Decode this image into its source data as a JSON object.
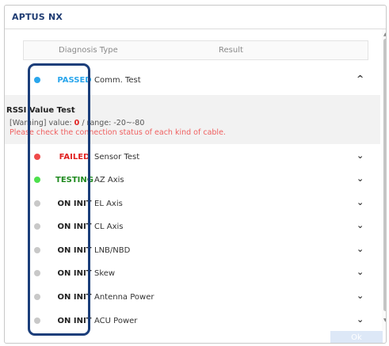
{
  "window": {
    "title": "APTUS NX"
  },
  "table_header": {
    "type_label": "Diagnosis Type",
    "result_label": "Result"
  },
  "rows": [
    {
      "status": "PASSED",
      "type": "Comm. Test",
      "dot_color": "#2aa6ec",
      "status_color": "#2aa6ec",
      "chevron": "^"
    },
    {
      "status": "FAILED",
      "type": "Sensor Test",
      "dot_color": "#ef4a4a",
      "status_color": "#e02020",
      "chevron": "⌄"
    },
    {
      "status": "TESTING",
      "type": "AZ Axis",
      "dot_color": "#4de04d",
      "status_color": "#1f8a1f",
      "chevron": "⌄"
    },
    {
      "status": "ON INIT",
      "type": "EL Axis",
      "dot_color": "#c8c8c8",
      "status_color": "#222222",
      "chevron": "⌄"
    },
    {
      "status": "ON INIT",
      "type": "CL Axis",
      "dot_color": "#c8c8c8",
      "status_color": "#222222",
      "chevron": "⌄"
    },
    {
      "status": "ON INIT",
      "type": "LNB/NBD",
      "dot_color": "#c8c8c8",
      "status_color": "#222222",
      "chevron": "⌄"
    },
    {
      "status": "ON INIT",
      "type": "Skew",
      "dot_color": "#c8c8c8",
      "status_color": "#222222",
      "chevron": "⌄"
    },
    {
      "status": "ON INIT",
      "type": "Antenna Power",
      "dot_color": "#c8c8c8",
      "status_color": "#222222",
      "chevron": "⌄"
    },
    {
      "status": "ON INIT",
      "type": "ACU Power",
      "dot_color": "#c8c8c8",
      "status_color": "#222222",
      "chevron": "⌄"
    }
  ],
  "detail": {
    "title": "RSSI Value Test",
    "warning_prefix": "[Warning] value: ",
    "warning_value": "0",
    "warning_suffix": " / range: -20~-80",
    "message": "Please check the connection status of each kind of cable."
  },
  "footer": {
    "ok_label": "Ok"
  }
}
